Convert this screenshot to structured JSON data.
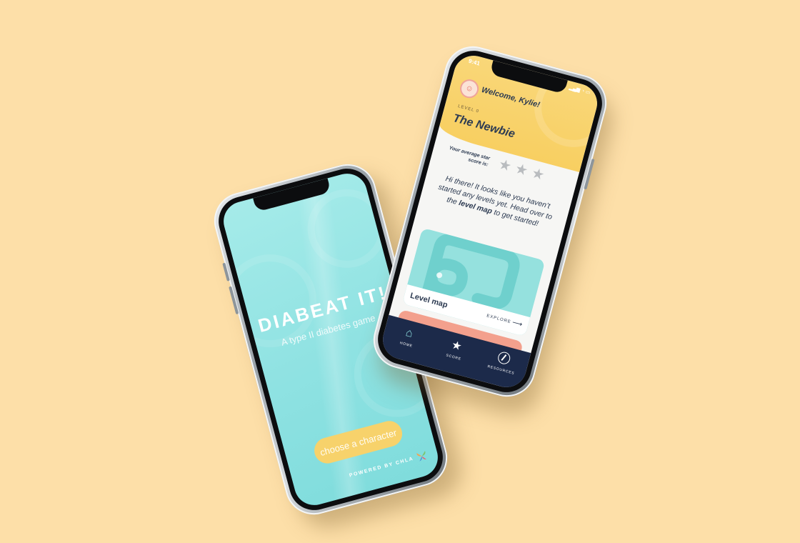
{
  "colors": {
    "background": "#fddfa8",
    "teal": "#8fe2e2",
    "yellow": "#f8cf61",
    "navy": "#1c2a4a",
    "coral": "#f3a08d"
  },
  "splash": {
    "title": "DIABEAT IT!",
    "subtitle": "A type II diabetes game",
    "cta_label": "choose a character",
    "powered_by": "POWERED BY CHLA"
  },
  "home": {
    "status_time": "9:41",
    "welcome": "Welcome, Kylie!",
    "level_label": "LEVEL 0",
    "level_name": "The Newbie",
    "score_label": "Your average star score is:",
    "stars": {
      "filled": 0,
      "total": 3
    },
    "message": {
      "part1": "Hi there! It looks like you haven’t started any levels yet. Head over to the ",
      "bold": "level map",
      "part2": " to get started!"
    },
    "map_card": {
      "title": "Level map",
      "action": "EXPLORE"
    },
    "tabs": [
      {
        "label": "HOME",
        "icon": "home-icon"
      },
      {
        "label": "SCORE",
        "icon": "star-icon"
      },
      {
        "label": "RESOURCES",
        "icon": "compass-icon"
      }
    ]
  }
}
